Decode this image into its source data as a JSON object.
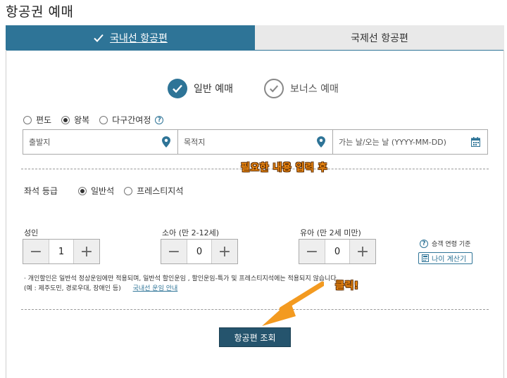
{
  "page_title": "항공권 예매",
  "tabs": [
    {
      "label": "국내선 항공편",
      "active": true
    },
    {
      "label": "국제선 항공편",
      "active": false
    }
  ],
  "booking_types": [
    {
      "label": "일반 예매",
      "selected": true
    },
    {
      "label": "보너스 예매",
      "selected": false
    }
  ],
  "trip_types": [
    {
      "label": "편도",
      "selected": false
    },
    {
      "label": "왕복",
      "selected": true
    },
    {
      "label": "다구간여정",
      "selected": false
    }
  ],
  "fields": {
    "origin_placeholder": "출발지",
    "destination_placeholder": "목적지",
    "dates_placeholder": "가는 날/오는 날 (YYYY-MM-DD)"
  },
  "annotations": {
    "input_note": "필요한 내용 입력 후",
    "click_note": "클릭!"
  },
  "seat": {
    "label": "좌석 등급",
    "options": [
      {
        "label": "일반석",
        "selected": true
      },
      {
        "label": "프레스티지석",
        "selected": false
      }
    ]
  },
  "passengers": [
    {
      "label": "성인",
      "count": "1"
    },
    {
      "label": "소아 (만 2-12세)",
      "count": "0"
    },
    {
      "label": "유아 (만 2세 미만)",
      "count": "0"
    }
  ],
  "age_help": {
    "label": "승객 연령 기준",
    "calc_button": "나이 계산기"
  },
  "notice": {
    "line1": "· 개인할인은 일반석 정상운임에만 적용되며, 일반석 할인운임 , 할인운임-특가 및 프레스티지석에는 적용되지 않습니다.",
    "line2": "(예 : 제주도민, 경로우대, 장애인 등)",
    "link": "국내선 운임 안내"
  },
  "search_button": "항공편 조회",
  "colors": {
    "primary": "#2e7497",
    "button_dark": "#25546d",
    "annotation_orange": "#f08a12"
  }
}
